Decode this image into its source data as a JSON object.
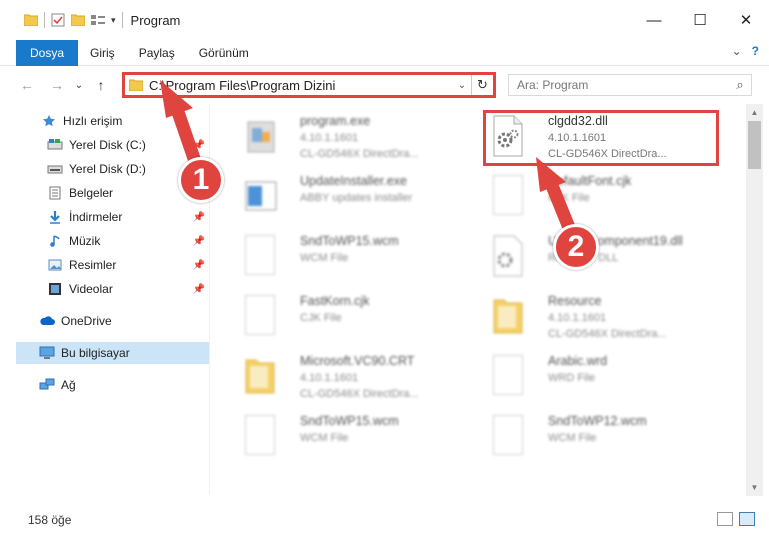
{
  "window": {
    "title": "Program",
    "minimize": "—",
    "maximize": "☐",
    "close": "✕"
  },
  "ribbon": {
    "tabs": [
      {
        "label": "Dosya"
      },
      {
        "label": "Giriş"
      },
      {
        "label": "Paylaş"
      },
      {
        "label": "Görünüm"
      }
    ],
    "expand": "⌄",
    "help": "?"
  },
  "nav": {
    "back": "←",
    "forward": "→",
    "recent": "⌄",
    "up": "↑",
    "address": "C:\\Program Files\\Program Dizini",
    "dropdown": "⌄",
    "refresh": "↻",
    "search_placeholder": "Ara: Program"
  },
  "sidebar": {
    "items": [
      {
        "label": "Hızlı erişim",
        "icon": "star-icon"
      },
      {
        "label": "Yerel Disk (C:)",
        "icon": "drive-icon",
        "pinned": true
      },
      {
        "label": "Yerel Disk (D:)",
        "icon": "drive-icon",
        "pinned": true
      },
      {
        "label": "Belgeler",
        "icon": "documents-icon",
        "pinned": true
      },
      {
        "label": "İndirmeler",
        "icon": "download-icon",
        "pinned": true
      },
      {
        "label": "Müzik",
        "icon": "music-icon",
        "pinned": true
      },
      {
        "label": "Resimler",
        "icon": "pictures-icon",
        "pinned": true
      },
      {
        "label": "Videolar",
        "icon": "video-icon",
        "pinned": true
      },
      {
        "label": "OneDrive",
        "icon": "cloud-icon"
      },
      {
        "label": "Bu bilgisayar",
        "icon": "computer-icon"
      },
      {
        "label": "Ağ",
        "icon": "network-icon"
      }
    ]
  },
  "files": [
    {
      "name": "program.exe",
      "line1": "4.10.1.1601",
      "line2": "CL-GD546X DirectDra...",
      "icon": "exe-icon"
    },
    {
      "name": "clgdd32.dll",
      "line1": "4.10.1.1601",
      "line2": "CL-GD546X DirectDra...",
      "icon": "dll-gear-icon"
    },
    {
      "name": "UpdateInstaller.exe",
      "line1": "ABBY updates installer",
      "line2": "",
      "icon": "installer-icon"
    },
    {
      "name": "DefaultFont.cjk",
      "line1": "CJK File",
      "line2": "",
      "icon": "file-icon"
    },
    {
      "name": "SndToWP15.wcm",
      "line1": "WCM File",
      "line2": "",
      "icon": "file-icon"
    },
    {
      "name": "UpdateComponent19.dll",
      "line1": "Resource DLL",
      "line2": "",
      "icon": "dll-gear-icon"
    },
    {
      "name": "FastKorn.cjk",
      "line1": "CJK File",
      "line2": "",
      "icon": "file-icon"
    },
    {
      "name": "Resource",
      "line1": "4.10.1.1601",
      "line2": "CL-GD546X DirectDra...",
      "icon": "folder-icon"
    },
    {
      "name": "Microsoft.VC90.CRT",
      "line1": "4.10.1.1601",
      "line2": "CL-GD546X DirectDra...",
      "icon": "folder-icon"
    },
    {
      "name": "Arabic.wrd",
      "line1": "WRD File",
      "line2": "",
      "icon": "file-icon"
    },
    {
      "name": "SndToWP15.wcm",
      "line1": "WCM File",
      "line2": "",
      "icon": "file-icon"
    },
    {
      "name": "SndToWP12.wcm",
      "line1": "WCM File",
      "line2": "",
      "icon": "file-icon"
    }
  ],
  "status": {
    "count": "158 öğe"
  },
  "annotations": {
    "badge1": "1",
    "badge2": "2"
  },
  "colors": {
    "accent": "#1979ca",
    "highlight": "#e0443f",
    "selected": "#cce4f7"
  }
}
